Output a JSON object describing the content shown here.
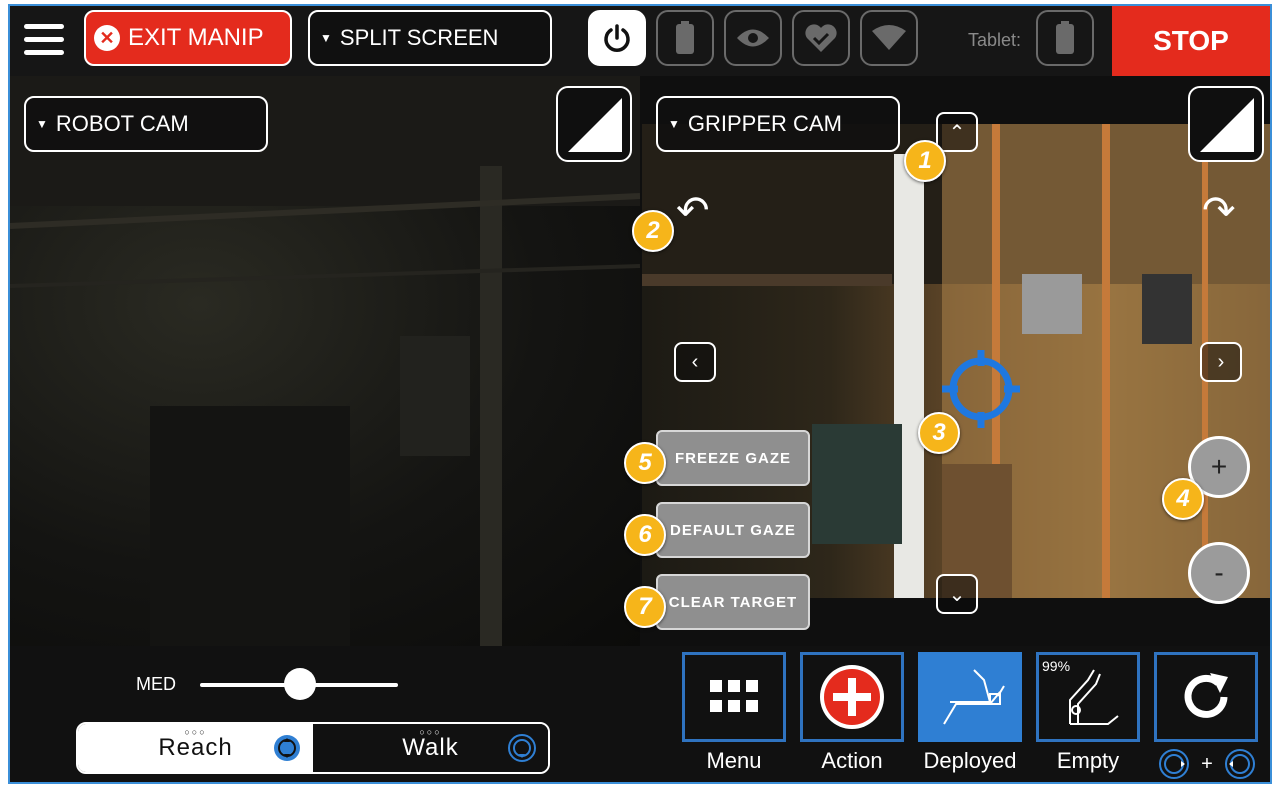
{
  "topbar": {
    "exit_label": "EXIT MANIP",
    "split_label": "SPLIT SCREEN",
    "tablet_label": "Tablet:",
    "stop_label": "STOP"
  },
  "status_icons": [
    "power-icon",
    "battery-icon",
    "eye-icon",
    "heart-check-icon",
    "wifi-icon",
    "tablet-battery-icon"
  ],
  "left_cam": {
    "label": "ROBOT CAM"
  },
  "right_cam": {
    "label": "GRIPPER CAM"
  },
  "gaze_buttons": {
    "freeze": "FREEZE GAZE",
    "default": "DEFAULT GAZE",
    "clear": "CLEAR TARGET"
  },
  "zoom": {
    "in_label": "+",
    "out_label": "-"
  },
  "badges": [
    "1",
    "2",
    "3",
    "4",
    "5",
    "6",
    "7"
  ],
  "speed": {
    "label": "MED",
    "level": 0.5
  },
  "mode_toggle": {
    "reach": "Reach",
    "walk": "Walk",
    "dots": "○○○"
  },
  "actions": {
    "menu": "Menu",
    "action": "Action",
    "deployed": "Deployed",
    "empty": "Empty",
    "empty_pct": "99%",
    "combo_plus": "+"
  },
  "colors": {
    "accent": "#2f73c0",
    "stop": "#e42b1d",
    "badge": "#f6b51a",
    "target": "#1f78e0"
  }
}
